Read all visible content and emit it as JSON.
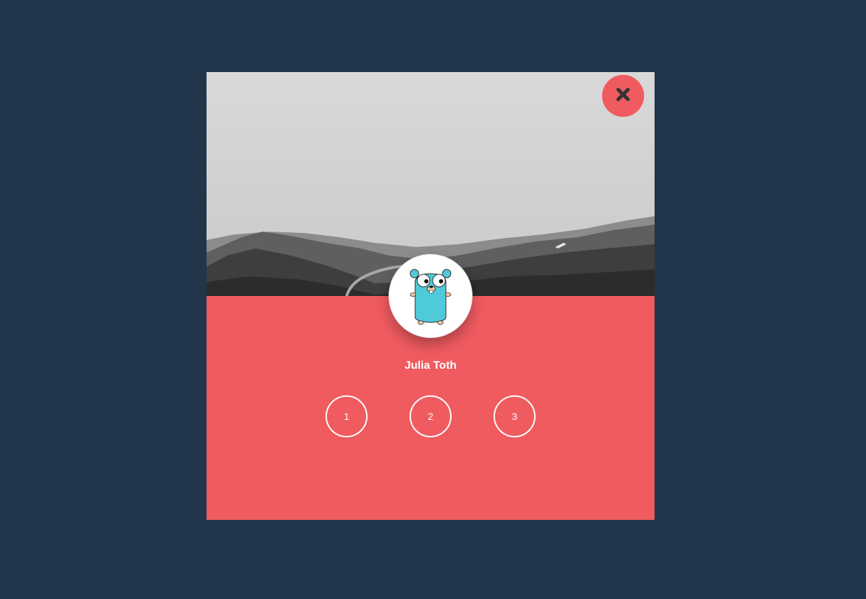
{
  "profile": {
    "name": "Julia Toth",
    "avatar_icon": "gopher-mascot-icon",
    "cover_icon": "landscape-photo"
  },
  "close_button": {
    "icon": "close-icon",
    "color": "#f05b60"
  },
  "steps": [
    "1",
    "2",
    "3"
  ],
  "colors": {
    "background": "#21354b",
    "accent": "#f05b60",
    "text": "#ffffff"
  }
}
